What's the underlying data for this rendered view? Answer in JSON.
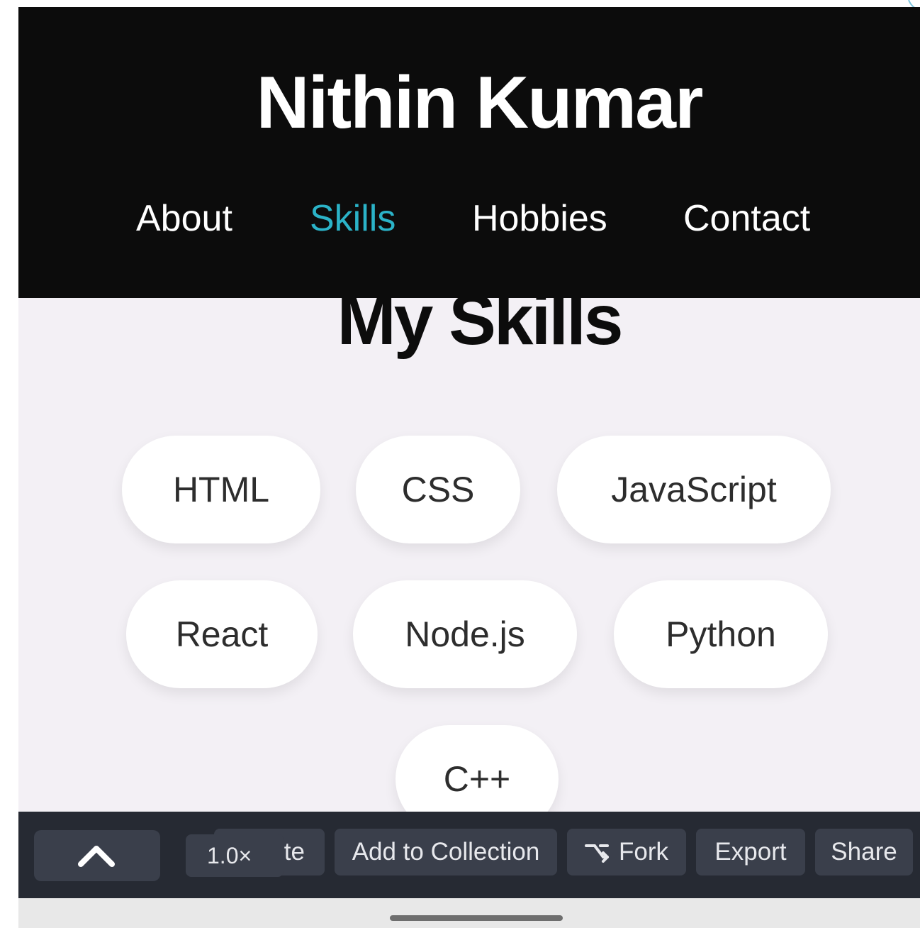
{
  "site": {
    "title": "Nithin Kumar"
  },
  "nav": {
    "items": [
      {
        "label": "About"
      },
      {
        "label": "Skills",
        "active": true
      },
      {
        "label": "Hobbies"
      },
      {
        "label": "Contact"
      }
    ],
    "active_color": "#2bb3c8"
  },
  "skills": {
    "title": "My Skills",
    "items": [
      "HTML",
      "CSS",
      "JavaScript",
      "React",
      "Node.js",
      "Python",
      "C++"
    ]
  },
  "toolbar": {
    "up_icon": "chevron-up-icon",
    "zoom": "1.0×",
    "partial_label": "te",
    "add_to_collection": "Add to Collection",
    "fork": "Fork",
    "fork_icon": "fork-icon",
    "export": "Export",
    "share": "Share"
  },
  "colors": {
    "header_bg": "#0c0c0c",
    "content_bg": "#f3f0f5",
    "toolbar_bg": "#262a33",
    "button_bg": "#3a3f4b"
  }
}
